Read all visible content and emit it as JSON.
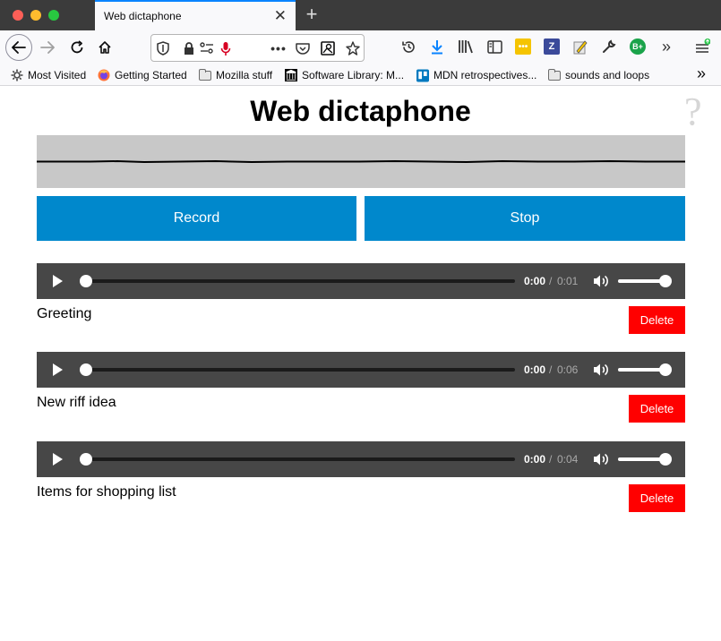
{
  "browser": {
    "tab_title": "Web dictaphone",
    "tab_close": "✕",
    "new_tab": "+",
    "overflow": "»"
  },
  "bookmarks": [
    {
      "label": "Most Visited",
      "icon": "gear-icon"
    },
    {
      "label": "Getting Started",
      "icon": "firefox-icon"
    },
    {
      "label": "Mozilla stuff",
      "icon": "folder-icon"
    },
    {
      "label": "Software Library: M...",
      "icon": "archive-icon"
    },
    {
      "label": "MDN retrospectives...",
      "icon": "trello-icon"
    },
    {
      "label": "sounds and loops",
      "icon": "folder-icon"
    }
  ],
  "page": {
    "title": "Web dictaphone",
    "help": "?",
    "record_label": "Record",
    "stop_label": "Stop"
  },
  "clips": [
    {
      "name": "Greeting",
      "current": "0:00",
      "separator": "/",
      "duration": "0:01",
      "delete_label": "Delete",
      "progress": 0,
      "volume": 1
    },
    {
      "name": "New riff idea",
      "current": "0:00",
      "separator": "/",
      "duration": "0:06",
      "delete_label": "Delete",
      "progress": 0,
      "volume": 1
    },
    {
      "name": "Items for shopping list",
      "current": "0:00",
      "separator": "/",
      "duration": "0:04",
      "delete_label": "Delete",
      "progress": 0,
      "volume": 1
    }
  ],
  "colors": {
    "accent": "#0088cc",
    "delete": "#ff0000",
    "player": "#474747",
    "visualizer": "#c8c8c8"
  }
}
